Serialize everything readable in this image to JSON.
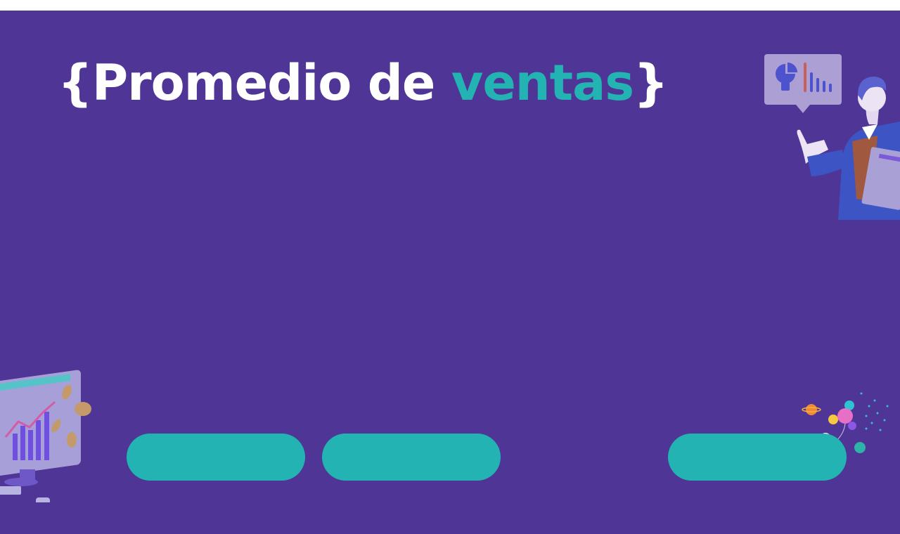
{
  "title": {
    "open_brace": "{",
    "word1": "Promedio de ",
    "word2": "ventas",
    "close_brace": "}"
  },
  "buttons": [
    {
      "label": ""
    },
    {
      "label": ""
    },
    {
      "label": ""
    }
  ],
  "colors": {
    "background": "#4e3596",
    "accent": "#24b3b3",
    "title_text": "#ffffff",
    "page_border": "#ffffff"
  },
  "icons": [
    "presenter-illustration",
    "chart-speech-bubble-icon",
    "monitor-chart-illustration",
    "coins-icon",
    "astronaut-balloons-illustration"
  ]
}
